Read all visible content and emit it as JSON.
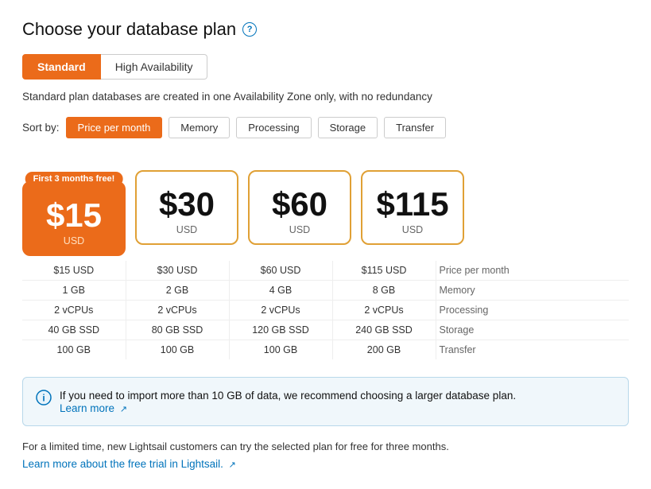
{
  "page": {
    "title": "Choose your database plan",
    "help_icon": "?",
    "tabs": [
      {
        "id": "standard",
        "label": "Standard",
        "active": true
      },
      {
        "id": "high-availability",
        "label": "High Availability",
        "active": false
      }
    ],
    "description": "Standard plan databases are created in one Availability Zone only, with no redundancy",
    "sort": {
      "label": "Sort by:",
      "options": [
        {
          "id": "price",
          "label": "Price per month",
          "active": true
        },
        {
          "id": "memory",
          "label": "Memory",
          "active": false
        },
        {
          "id": "processing",
          "label": "Processing",
          "active": false
        },
        {
          "id": "storage",
          "label": "Storage",
          "active": false
        },
        {
          "id": "transfer",
          "label": "Transfer",
          "active": false
        }
      ]
    },
    "plans": [
      {
        "price": "$15",
        "currency": "USD",
        "featured": true,
        "free_badge": "First 3 months free!",
        "details": {
          "price_month": "$15 USD",
          "memory": "1 GB",
          "processing": "2 vCPUs",
          "storage": "40 GB SSD",
          "transfer": "100 GB"
        }
      },
      {
        "price": "$30",
        "currency": "USD",
        "featured": false,
        "free_badge": null,
        "details": {
          "price_month": "$30 USD",
          "memory": "2 GB",
          "processing": "2 vCPUs",
          "storage": "80 GB SSD",
          "transfer": "100 GB"
        }
      },
      {
        "price": "$60",
        "currency": "USD",
        "featured": false,
        "free_badge": null,
        "details": {
          "price_month": "$60 USD",
          "memory": "4 GB",
          "processing": "2 vCPUs",
          "storage": "120 GB SSD",
          "transfer": "100 GB"
        }
      },
      {
        "price": "$115",
        "currency": "USD",
        "featured": false,
        "free_badge": null,
        "details": {
          "price_month": "$115 USD",
          "memory": "8 GB",
          "processing": "2 vCPUs",
          "storage": "240 GB SSD",
          "transfer": "200 GB"
        }
      }
    ],
    "row_labels": [
      "Price per month",
      "Memory",
      "Processing",
      "Storage",
      "Transfer"
    ],
    "info_message": "If you need to import more than 10 GB of data, we recommend choosing a larger database plan.",
    "info_learn_more": "Learn more",
    "footer_text": "For a limited time, new Lightsail customers can try the selected plan for free for three months.",
    "footer_learn_more": "Learn more about the free trial in Lightsail."
  }
}
